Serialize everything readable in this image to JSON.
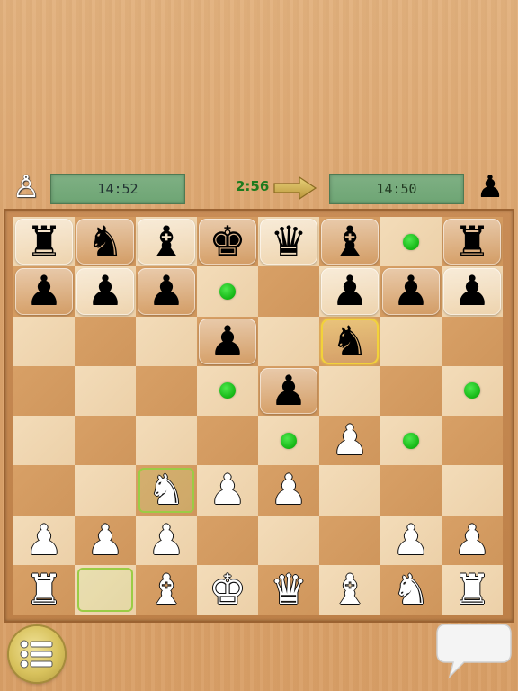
{
  "players": {
    "white_indicator": "♙",
    "black_indicator": "♟",
    "white_clock": "14:52",
    "black_clock": "14:50"
  },
  "move_timer": "2:56",
  "colors": {
    "clock_bg": "#7fb084",
    "move_timer": "#1e7b1e",
    "move_dot": "#14b614",
    "selected_square": "#f2d23a",
    "last_move": "#8bd25a"
  },
  "icons": {
    "turn": "turn-arrow-icon",
    "menu": "menu-list-icon",
    "chat": "chat-bubble-icon"
  },
  "board": [
    [
      "br",
      "bn",
      "bb",
      "bk",
      "bq",
      "bb",
      "",
      "br"
    ],
    [
      "bp",
      "bp",
      "bp",
      "",
      "",
      "bp",
      "bp",
      "bp"
    ],
    [
      "",
      "",
      "",
      "bp",
      "",
      "bn",
      "",
      ""
    ],
    [
      "",
      "",
      "",
      "",
      "bp",
      "",
      "",
      ""
    ],
    [
      "",
      "",
      "",
      "",
      "",
      "wp",
      "",
      ""
    ],
    [
      "",
      "",
      "wn",
      "wp",
      "wp",
      "",
      "",
      ""
    ],
    [
      "wp",
      "wp",
      "wp",
      "",
      "",
      "",
      "wp",
      "wp"
    ],
    [
      "wr",
      "",
      "wb",
      "wk",
      "wq",
      "wb",
      "wn",
      "wr"
    ]
  ],
  "move_hints": [
    [
      0,
      6
    ],
    [
      1,
      3
    ],
    [
      3,
      3
    ],
    [
      3,
      7
    ],
    [
      4,
      4
    ],
    [
      4,
      6
    ]
  ],
  "selected": [
    2,
    5
  ],
  "last_move": [
    [
      5,
      2
    ],
    [
      7,
      1
    ]
  ]
}
